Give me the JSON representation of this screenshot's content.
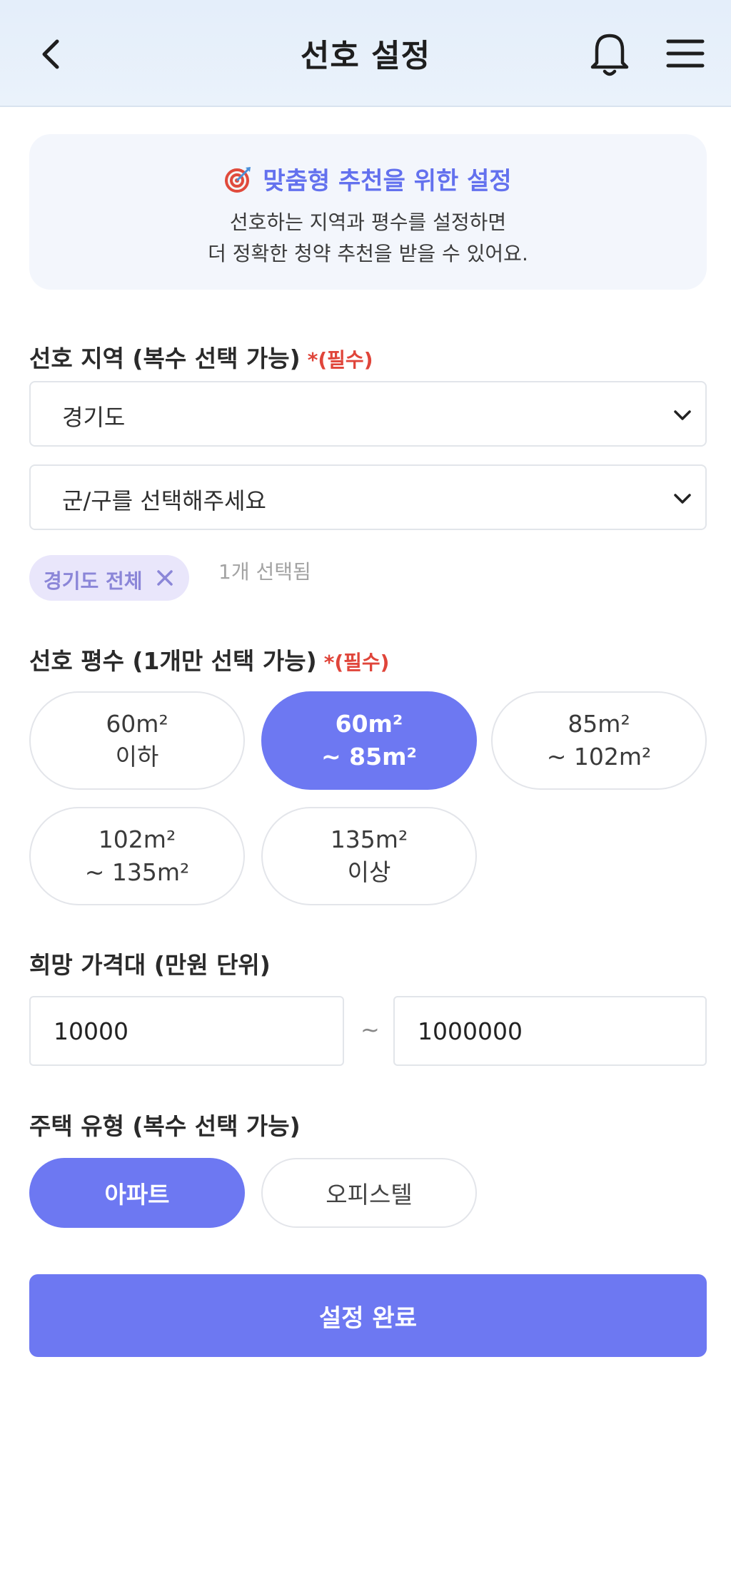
{
  "header": {
    "title": "선호 설정"
  },
  "info_card": {
    "title": "맞춤형 추천을 위한 설정",
    "line1": "선호하는 지역과 평수를 설정하면",
    "line2": "더 정확한 청약 추천을 받을 수 있어요."
  },
  "region": {
    "label": "선호 지역 (복수 선택 가능)",
    "required": "*(필수)",
    "province_value": "경기도",
    "district_placeholder": "군/구를 선택해주세요",
    "chip_label": "경기도 전체",
    "selected_count": "1개 선택됨"
  },
  "size": {
    "label": "선호 평수 (1개만 선택 가능)",
    "required": "*(필수)",
    "options": [
      {
        "line1": "60m²",
        "line2": "이하",
        "selected": false
      },
      {
        "line1": "60m²",
        "line2": "~ 85m²",
        "selected": true
      },
      {
        "line1": "85m²",
        "line2": "~ 102m²",
        "selected": false
      },
      {
        "line1": "102m²",
        "line2": "~ 135m²",
        "selected": false
      },
      {
        "line1": "135m²",
        "line2": "이상",
        "selected": false
      }
    ]
  },
  "price": {
    "label": "희망 가격대 (만원 단위)",
    "min": "10000",
    "separator": "~",
    "max": "1000000"
  },
  "house_type": {
    "label": "주택 유형 (복수 선택 가능)",
    "options": [
      {
        "label": "아파트",
        "selected": true
      },
      {
        "label": "오피스텔",
        "selected": false
      }
    ]
  },
  "submit_label": "설정 완료",
  "colors": {
    "accent": "#6d78f2",
    "required": "#e0453a",
    "chip_bg": "#e9e6fb",
    "header_bg": "#e6effa"
  }
}
